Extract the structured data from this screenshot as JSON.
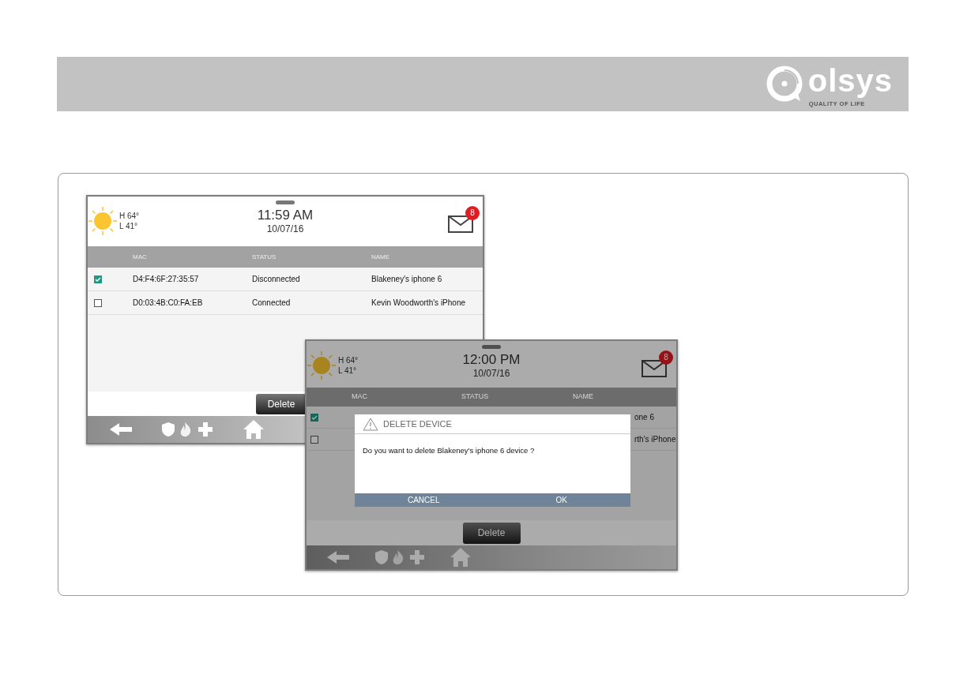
{
  "header": {
    "logo_text": "olsys",
    "tagline": "QUALITY OF LIFE"
  },
  "screens": [
    {
      "weather": {
        "high": "H 64°",
        "low": "L 41°"
      },
      "time": "11:59 AM",
      "date": "10/07/16",
      "mail_count": "8",
      "columns": [
        "MAC",
        "STATUS",
        "NAME"
      ],
      "rows": [
        {
          "checked": true,
          "mac": "D4:F4:6F:27:35:57",
          "status": "Disconnected",
          "name": "Blakeney's iphone 6"
        },
        {
          "checked": false,
          "mac": "D0:03:4B:C0:FA:EB",
          "status": "Connected",
          "name": "Kevin Woodworth's iPhone"
        }
      ],
      "delete_button": "Delete"
    },
    {
      "weather": {
        "high": "H 64°",
        "low": "L 41°"
      },
      "time": "12:00 PM",
      "date": "10/07/16",
      "mail_count": "8",
      "columns": [
        "MAC",
        "STATUS",
        "NAME"
      ],
      "rows": [
        {
          "checked": true,
          "name": "one 6"
        },
        {
          "checked": false,
          "name": "rth's iPhone"
        }
      ],
      "delete_button": "Delete",
      "dialog": {
        "title": "DELETE DEVICE",
        "message": "Do you want to delete Blakeney's iphone 6 device ?",
        "buttons": [
          "CANCEL",
          "OK"
        ]
      }
    }
  ]
}
